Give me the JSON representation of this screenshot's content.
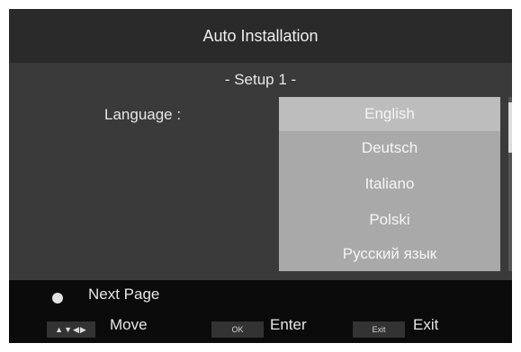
{
  "title": "Auto Installation",
  "subtitle": "- Setup 1 -",
  "language_label": "Language :",
  "languages": [
    "English",
    "Deutsch",
    "Italiano",
    "Polski",
    "Русский язык"
  ],
  "selected_index": 0,
  "footer": {
    "next_page": "Next Page",
    "move": "Move",
    "ok_key": "OK",
    "enter": "Enter",
    "exit_key": "Exit",
    "exit": "Exit",
    "arrows_glyphs": "▲▼◀▶"
  },
  "colors": {
    "panel": "#3a3a3a",
    "title_bar": "#2a2a2a",
    "list_bg": "#a9a9a9",
    "list_selected": "#bdbdbd"
  }
}
